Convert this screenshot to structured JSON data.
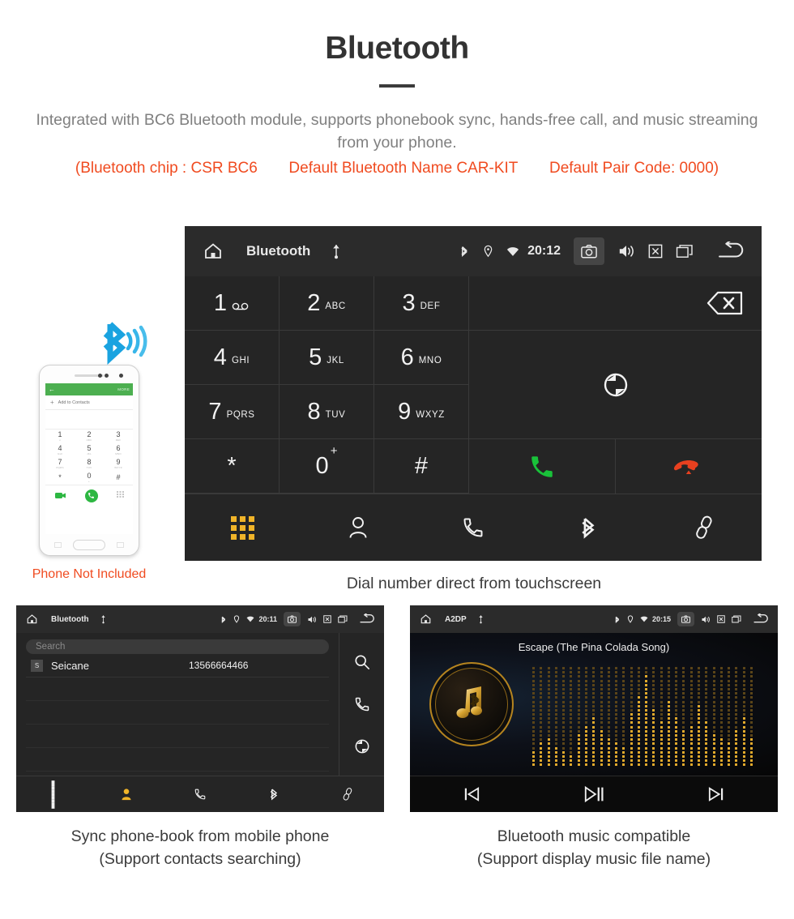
{
  "header": {
    "title": "Bluetooth",
    "intro": "Integrated with BC6 Bluetooth module, supports phonebook sync, hands-free call, and music streaming from your phone.",
    "spec_open": "(Bluetooth chip : CSR BC6",
    "spec_name": "Default Bluetooth Name CAR-KIT",
    "spec_pair": "Default Pair Code: 0000)",
    "accent_color": "#f04b20",
    "body_color": "#808080"
  },
  "dial_screen": {
    "status": {
      "home_icon": "home-icon",
      "title": "Bluetooth",
      "usb_icon": "usb-icon",
      "bluetooth_icon": "bluetooth-icon",
      "location_icon": "location-icon",
      "wifi_icon": "wifi-icon",
      "clock": "20:12",
      "camera_icon": "camera-icon",
      "volume_icon": "volume-icon",
      "close_icon": "close-box-icon",
      "recents_icon": "recents-icon",
      "back_icon": "back-arrow-icon"
    },
    "keys": [
      {
        "digit": "1",
        "letters": "",
        "voicemail": true
      },
      {
        "digit": "2",
        "letters": "ABC"
      },
      {
        "digit": "3",
        "letters": "DEF"
      },
      {
        "digit": "4",
        "letters": "GHI"
      },
      {
        "digit": "5",
        "letters": "JKL"
      },
      {
        "digit": "6",
        "letters": "MNO"
      },
      {
        "digit": "7",
        "letters": "PQRS"
      },
      {
        "digit": "8",
        "letters": "TUV"
      },
      {
        "digit": "9",
        "letters": "WXYZ"
      },
      {
        "digit": "*",
        "letters": ""
      },
      {
        "digit": "0",
        "letters": "",
        "plus": "+"
      },
      {
        "digit": "#",
        "letters": ""
      }
    ],
    "number_field_value": "",
    "backspace_icon": "backspace-icon",
    "sync_icon": "sync-icon",
    "call_icon": "call-icon",
    "hangup_icon": "hangup-icon",
    "call_color": "#19c23a",
    "hangup_color": "#e8401f",
    "tabs": [
      {
        "name": "dialpad",
        "icon": "dialpad-icon",
        "active": true
      },
      {
        "name": "contacts",
        "icon": "contacts-icon",
        "active": false
      },
      {
        "name": "call-log",
        "icon": "phone-handset-icon",
        "active": false
      },
      {
        "name": "bluetooth",
        "icon": "bluetooth-icon",
        "active": false
      },
      {
        "name": "link",
        "icon": "link-icon",
        "active": false
      }
    ],
    "active_color": "#f0b429",
    "caption": "Dial number direct from touchscreen"
  },
  "phone_illustration": {
    "appbar_back": "←",
    "appbar_more": "MORE",
    "add_label": "Add to Contacts",
    "add_plus": "+",
    "keys": [
      {
        "n": "1",
        "s": "∞"
      },
      {
        "n": "2",
        "s": "ABC"
      },
      {
        "n": "3",
        "s": "DEF"
      },
      {
        "n": "4",
        "s": "GHI"
      },
      {
        "n": "5",
        "s": "JKL"
      },
      {
        "n": "6",
        "s": "MNO"
      },
      {
        "n": "7",
        "s": "PQRS"
      },
      {
        "n": "8",
        "s": "TUV"
      },
      {
        "n": "9",
        "s": "WXYZ"
      },
      {
        "n": "*",
        "s": ""
      },
      {
        "n": "0",
        "s": "+"
      },
      {
        "n": "#",
        "s": ""
      }
    ],
    "not_included_label": "Phone Not Included",
    "not_included_color": "#f04b20",
    "bluetooth_badge_icon": "bluetooth-signal-icon"
  },
  "phonebook_screen": {
    "status": {
      "title": "Bluetooth",
      "clock": "20:11"
    },
    "search_placeholder": "Search",
    "contacts": [
      {
        "initial": "S",
        "name": "Seicane",
        "number": "13566664466"
      }
    ],
    "empty_rows": 4,
    "rail": [
      {
        "name": "search",
        "icon": "search-icon"
      },
      {
        "name": "call",
        "icon": "phone-handset-icon"
      },
      {
        "name": "sync",
        "icon": "sync-icon"
      }
    ],
    "tabs": [
      {
        "name": "dialpad",
        "icon": "dialpad-icon",
        "active": false
      },
      {
        "name": "contacts",
        "icon": "contacts-icon",
        "active": true
      },
      {
        "name": "call-log",
        "icon": "phone-handset-icon",
        "active": false
      },
      {
        "name": "bluetooth",
        "icon": "bluetooth-icon",
        "active": false
      },
      {
        "name": "link",
        "icon": "link-icon",
        "active": false
      }
    ],
    "caption_line1": "Sync phone-book from mobile phone",
    "caption_line2": "(Support contacts searching)"
  },
  "music_screen": {
    "status": {
      "title": "A2DP",
      "clock": "20:15"
    },
    "song_title": "Escape (The Pina Colada Song)",
    "album_icon": "music-note-bluetooth-icon",
    "visualizer": "dot-matrix-equalizer",
    "eq_levels": [
      4,
      6,
      7,
      5,
      4,
      3,
      8,
      10,
      12,
      9,
      7,
      6,
      5,
      13,
      17,
      22,
      14,
      11,
      16,
      12,
      9,
      10,
      15,
      11,
      8,
      7,
      6,
      9,
      12,
      7
    ],
    "controls": [
      {
        "name": "previous",
        "icon": "skip-previous-icon",
        "label": "⏮"
      },
      {
        "name": "play-pause",
        "icon": "play-pause-icon",
        "label": "⏯"
      },
      {
        "name": "next",
        "icon": "skip-next-icon",
        "label": "⏭"
      }
    ],
    "caption_line1": "Bluetooth music compatible",
    "caption_line2": "(Support display music file name)"
  }
}
